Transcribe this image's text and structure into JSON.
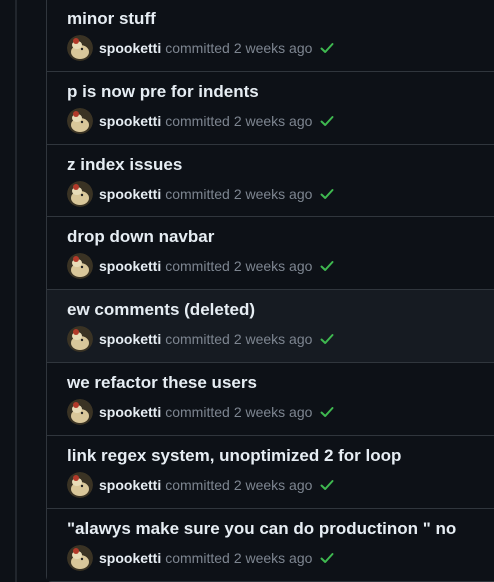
{
  "commits": [
    {
      "title": "minor stuff",
      "author": "spooketti",
      "verb": "committed",
      "time": "2 weeks ago",
      "status": "success"
    },
    {
      "title": "p is now pre for indents",
      "author": "spooketti",
      "verb": "committed",
      "time": "2 weeks ago",
      "status": "success"
    },
    {
      "title": "z index issues",
      "author": "spooketti",
      "verb": "committed",
      "time": "2 weeks ago",
      "status": "success"
    },
    {
      "title": "drop down navbar",
      "author": "spooketti",
      "verb": "committed",
      "time": "2 weeks ago",
      "status": "success"
    },
    {
      "title": "ew comments (deleted)",
      "author": "spooketti",
      "verb": "committed",
      "time": "2 weeks ago",
      "status": "success"
    },
    {
      "title": "we refactor these users",
      "author": "spooketti",
      "verb": "committed",
      "time": "2 weeks ago",
      "status": "success"
    },
    {
      "title": "link regex system, unoptimized 2 for loop",
      "author": "spooketti",
      "verb": "committed",
      "time": "2 weeks ago",
      "status": "success"
    },
    {
      "title": "\"alawys make sure you can do productinon \" no",
      "author": "spooketti",
      "verb": "committed",
      "time": "2 weeks ago",
      "status": "success"
    }
  ],
  "colors": {
    "success": "#3fb950",
    "background": "#0d1117",
    "hover_background": "#161b22",
    "border": "#30363d",
    "text": "#e6edf3",
    "muted": "#7d8590"
  },
  "icons": {
    "status": "check-icon",
    "avatar": "user-avatar"
  }
}
